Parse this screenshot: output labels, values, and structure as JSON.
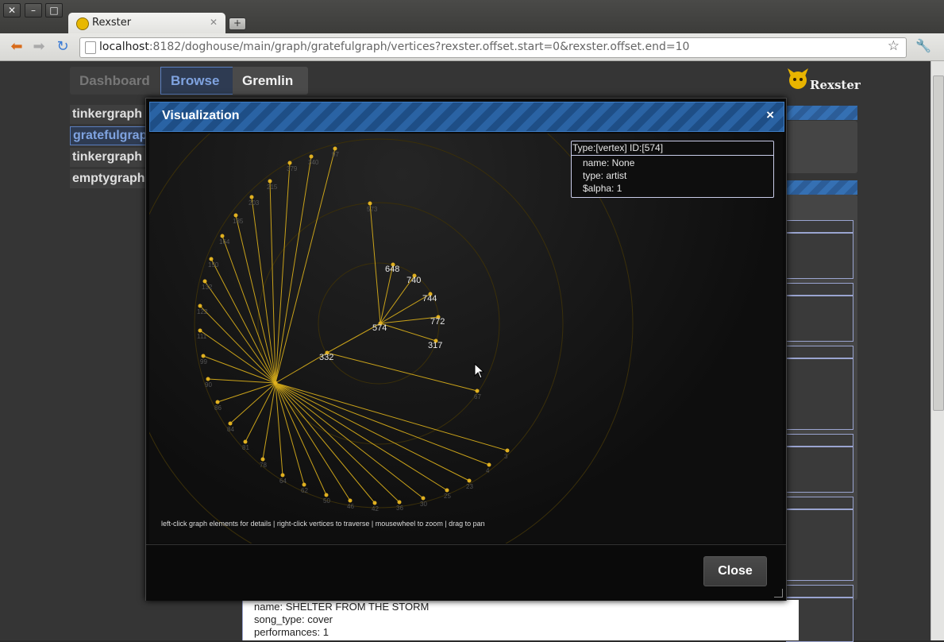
{
  "window": {
    "tab_title": "Rexster",
    "url_host": "localhost",
    "url_rest": ":8182/doghouse/main/graph/gratefulgraph/vertices?rexster.offset.start=0&rexster.offset.end=10"
  },
  "nav": {
    "tabs": [
      "Dashboard",
      "Browse",
      "Gremlin"
    ],
    "active": "Browse"
  },
  "logo_text": "Rexster",
  "graphs": [
    "tinkergraph",
    "gratefulgraph",
    "tinkergraph",
    "emptygraph"
  ],
  "modal": {
    "title": "Visualization",
    "close_x": "×",
    "close_button": "Close",
    "help_text": "left-click graph elements for details | right-click vertices to traverse | mousewheel to zoom | drag to pan"
  },
  "infobox": {
    "header": "Type:[vertex] ID:[574]",
    "rows": [
      "name: None",
      "type: artist",
      "$alpha: 1"
    ]
  },
  "graph": {
    "center_vertex": "574",
    "inner_vertices": [
      "648",
      "740",
      "744",
      "772",
      "317"
    ],
    "mid_vertices": [
      "332",
      "573",
      "67"
    ],
    "outer_vertices": [
      "97",
      "340",
      "379",
      "215",
      "203",
      "185",
      "164",
      "150",
      "132",
      "122",
      "111",
      "99",
      "90",
      "86",
      "84",
      "81",
      "78",
      "64",
      "62",
      "50",
      "46",
      "42",
      "36",
      "30",
      "25",
      "23",
      "4",
      "3"
    ]
  },
  "background_detail": {
    "lines": [
      "name: SHELTER FROM THE STORM",
      "song_type: cover",
      "performances: 1"
    ]
  },
  "colors": {
    "edge": "#c9a21a",
    "node": "#e0b020",
    "ring": "#3a2f0a",
    "header": "#2a63a4"
  }
}
